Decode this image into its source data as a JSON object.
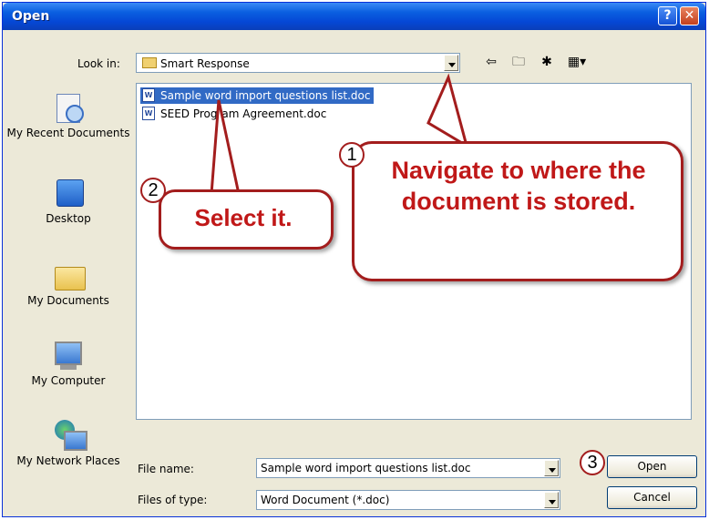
{
  "window": {
    "title": "Open"
  },
  "toolbar": {
    "look_in_label": "Look in:",
    "look_in_value": "Smart Response",
    "back_icon": "back-arrow-icon",
    "up_icon": "up-folder-icon",
    "new_folder_icon": "new-folder-icon",
    "views_icon": "views-menu-icon"
  },
  "places": [
    {
      "label": "My Recent Documents",
      "icon": "recent-documents-icon"
    },
    {
      "label": "Desktop",
      "icon": "desktop-icon"
    },
    {
      "label": "My Documents",
      "icon": "my-documents-icon"
    },
    {
      "label": "My Computer",
      "icon": "my-computer-icon"
    },
    {
      "label": "My Network Places",
      "icon": "network-places-icon"
    }
  ],
  "files": [
    {
      "name": "Sample word import questions list.doc",
      "selected": true
    },
    {
      "name": "SEED Program Agreement.doc",
      "selected": false
    }
  ],
  "bottom": {
    "file_name_label": "File name:",
    "file_name_value": "Sample word import questions list.doc",
    "file_type_label": "Files of type:",
    "file_type_value": "Word Document (*.doc)",
    "open_label": "Open",
    "cancel_label": "Cancel"
  },
  "callouts": {
    "c1": {
      "number": "1",
      "text": "Navigate to where the document is stored."
    },
    "c2": {
      "number": "2",
      "text": "Select it."
    },
    "c3": {
      "number": "3"
    }
  },
  "colors": {
    "title_bar": "#0a5fe0",
    "selection": "#316ac5",
    "callout_border": "#a31d1d",
    "callout_text": "#c01818"
  }
}
